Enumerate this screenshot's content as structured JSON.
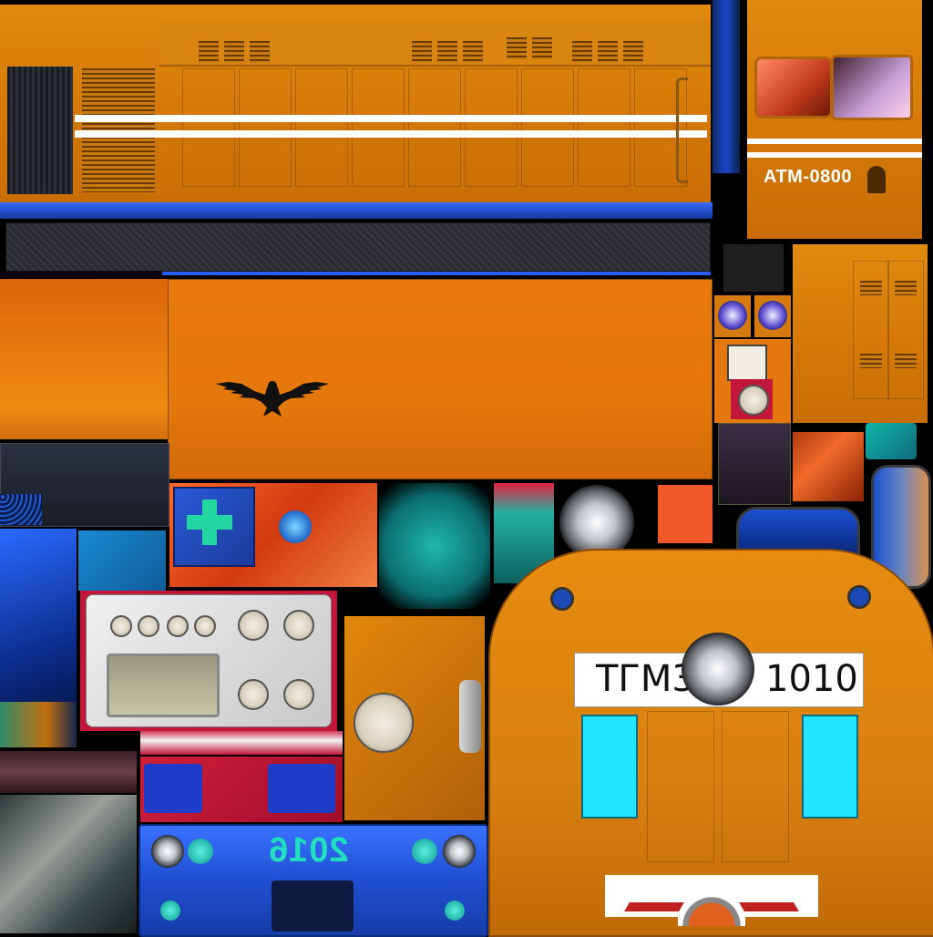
{
  "texture": {
    "side_number": "ATM-0800",
    "front_model": "TГМ3",
    "front_number": "1010",
    "plate_year": "2016"
  },
  "colors": {
    "body_orange": "#d97f0c",
    "stripe_white": "#ffffff",
    "frame_blue": "#1f4fd0",
    "window_cyan": "#22e6ff",
    "panel_red": "#c2163a"
  },
  "icons": {
    "eagle": "eagle-emblem-icon",
    "first_aid": "first-aid-cross-icon",
    "headlight": "headlight-icon"
  }
}
